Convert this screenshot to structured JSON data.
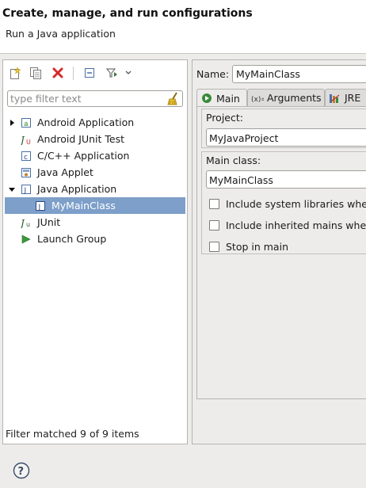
{
  "header": {
    "title": "Create, manage, and run configurations",
    "subtitle": "Run a Java application"
  },
  "left": {
    "toolbar": {
      "new_icon": "new-config-icon",
      "duplicate_icon": "duplicate-icon",
      "delete_icon": "delete-icon",
      "collapse_icon": "collapse-all-icon",
      "filter_icon": "filter-icon",
      "menu_icon": "chevron-down-icon"
    },
    "filter_placeholder": "type filter text",
    "tree": [
      {
        "label": "Android Application",
        "expanded": false,
        "level": 0
      },
      {
        "label": "Android JUnit Test",
        "level": 0
      },
      {
        "label": "C/C++ Application",
        "level": 0
      },
      {
        "label": "Java Applet",
        "level": 0
      },
      {
        "label": "Java Application",
        "expanded": true,
        "level": 0
      },
      {
        "label": "MyMainClass",
        "level": 1,
        "selected": true
      },
      {
        "label": "JUnit",
        "level": 0
      },
      {
        "label": "Launch Group",
        "level": 0
      }
    ],
    "status": "Filter matched 9 of 9 items"
  },
  "right": {
    "name_label": "Name:",
    "name_value": "MyMainClass",
    "tabs": [
      {
        "label": "Main",
        "icon": "main-tab-icon",
        "active": true
      },
      {
        "label": "Arguments",
        "icon": "arguments-icon"
      },
      {
        "label": "JRE",
        "icon": "jre-icon"
      }
    ],
    "project_label": "Project:",
    "project_value": "MyJavaProject",
    "main_class_label": "Main class:",
    "main_class_value": "MyMainClass",
    "checkboxes": [
      {
        "label": "Include system libraries when",
        "checked": false
      },
      {
        "label": "Include inherited mains when",
        "checked": false
      },
      {
        "label": "Stop in main",
        "checked": false
      }
    ]
  },
  "colors": {
    "selection": "#7d9fc9",
    "background": "#edeceb",
    "header_bg": "#ffffff"
  }
}
